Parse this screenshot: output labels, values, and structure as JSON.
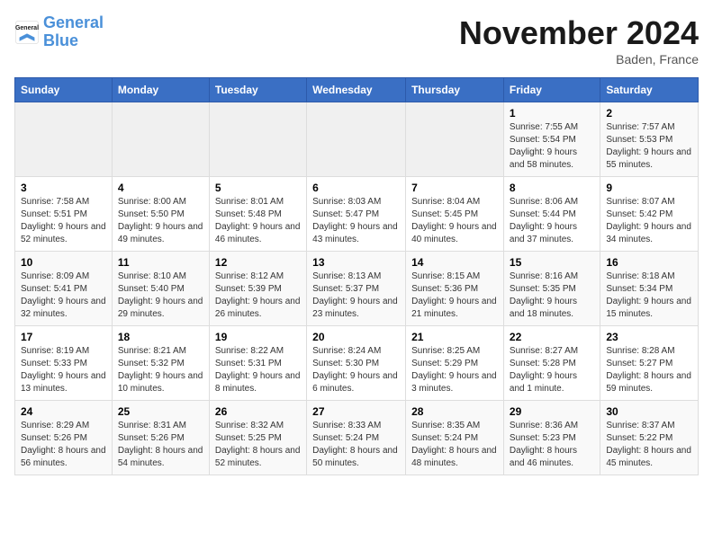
{
  "header": {
    "logo_line1": "General",
    "logo_line2": "Blue",
    "month": "November 2024",
    "location": "Baden, France"
  },
  "weekdays": [
    "Sunday",
    "Monday",
    "Tuesday",
    "Wednesday",
    "Thursday",
    "Friday",
    "Saturday"
  ],
  "weeks": [
    [
      {
        "day": "",
        "info": ""
      },
      {
        "day": "",
        "info": ""
      },
      {
        "day": "",
        "info": ""
      },
      {
        "day": "",
        "info": ""
      },
      {
        "day": "",
        "info": ""
      },
      {
        "day": "1",
        "info": "Sunrise: 7:55 AM\nSunset: 5:54 PM\nDaylight: 9 hours and 58 minutes."
      },
      {
        "day": "2",
        "info": "Sunrise: 7:57 AM\nSunset: 5:53 PM\nDaylight: 9 hours and 55 minutes."
      }
    ],
    [
      {
        "day": "3",
        "info": "Sunrise: 7:58 AM\nSunset: 5:51 PM\nDaylight: 9 hours and 52 minutes."
      },
      {
        "day": "4",
        "info": "Sunrise: 8:00 AM\nSunset: 5:50 PM\nDaylight: 9 hours and 49 minutes."
      },
      {
        "day": "5",
        "info": "Sunrise: 8:01 AM\nSunset: 5:48 PM\nDaylight: 9 hours and 46 minutes."
      },
      {
        "day": "6",
        "info": "Sunrise: 8:03 AM\nSunset: 5:47 PM\nDaylight: 9 hours and 43 minutes."
      },
      {
        "day": "7",
        "info": "Sunrise: 8:04 AM\nSunset: 5:45 PM\nDaylight: 9 hours and 40 minutes."
      },
      {
        "day": "8",
        "info": "Sunrise: 8:06 AM\nSunset: 5:44 PM\nDaylight: 9 hours and 37 minutes."
      },
      {
        "day": "9",
        "info": "Sunrise: 8:07 AM\nSunset: 5:42 PM\nDaylight: 9 hours and 34 minutes."
      }
    ],
    [
      {
        "day": "10",
        "info": "Sunrise: 8:09 AM\nSunset: 5:41 PM\nDaylight: 9 hours and 32 minutes."
      },
      {
        "day": "11",
        "info": "Sunrise: 8:10 AM\nSunset: 5:40 PM\nDaylight: 9 hours and 29 minutes."
      },
      {
        "day": "12",
        "info": "Sunrise: 8:12 AM\nSunset: 5:39 PM\nDaylight: 9 hours and 26 minutes."
      },
      {
        "day": "13",
        "info": "Sunrise: 8:13 AM\nSunset: 5:37 PM\nDaylight: 9 hours and 23 minutes."
      },
      {
        "day": "14",
        "info": "Sunrise: 8:15 AM\nSunset: 5:36 PM\nDaylight: 9 hours and 21 minutes."
      },
      {
        "day": "15",
        "info": "Sunrise: 8:16 AM\nSunset: 5:35 PM\nDaylight: 9 hours and 18 minutes."
      },
      {
        "day": "16",
        "info": "Sunrise: 8:18 AM\nSunset: 5:34 PM\nDaylight: 9 hours and 15 minutes."
      }
    ],
    [
      {
        "day": "17",
        "info": "Sunrise: 8:19 AM\nSunset: 5:33 PM\nDaylight: 9 hours and 13 minutes."
      },
      {
        "day": "18",
        "info": "Sunrise: 8:21 AM\nSunset: 5:32 PM\nDaylight: 9 hours and 10 minutes."
      },
      {
        "day": "19",
        "info": "Sunrise: 8:22 AM\nSunset: 5:31 PM\nDaylight: 9 hours and 8 minutes."
      },
      {
        "day": "20",
        "info": "Sunrise: 8:24 AM\nSunset: 5:30 PM\nDaylight: 9 hours and 6 minutes."
      },
      {
        "day": "21",
        "info": "Sunrise: 8:25 AM\nSunset: 5:29 PM\nDaylight: 9 hours and 3 minutes."
      },
      {
        "day": "22",
        "info": "Sunrise: 8:27 AM\nSunset: 5:28 PM\nDaylight: 9 hours and 1 minute."
      },
      {
        "day": "23",
        "info": "Sunrise: 8:28 AM\nSunset: 5:27 PM\nDaylight: 8 hours and 59 minutes."
      }
    ],
    [
      {
        "day": "24",
        "info": "Sunrise: 8:29 AM\nSunset: 5:26 PM\nDaylight: 8 hours and 56 minutes."
      },
      {
        "day": "25",
        "info": "Sunrise: 8:31 AM\nSunset: 5:26 PM\nDaylight: 8 hours and 54 minutes."
      },
      {
        "day": "26",
        "info": "Sunrise: 8:32 AM\nSunset: 5:25 PM\nDaylight: 8 hours and 52 minutes."
      },
      {
        "day": "27",
        "info": "Sunrise: 8:33 AM\nSunset: 5:24 PM\nDaylight: 8 hours and 50 minutes."
      },
      {
        "day": "28",
        "info": "Sunrise: 8:35 AM\nSunset: 5:24 PM\nDaylight: 8 hours and 48 minutes."
      },
      {
        "day": "29",
        "info": "Sunrise: 8:36 AM\nSunset: 5:23 PM\nDaylight: 8 hours and 46 minutes."
      },
      {
        "day": "30",
        "info": "Sunrise: 8:37 AM\nSunset: 5:22 PM\nDaylight: 8 hours and 45 minutes."
      }
    ]
  ]
}
